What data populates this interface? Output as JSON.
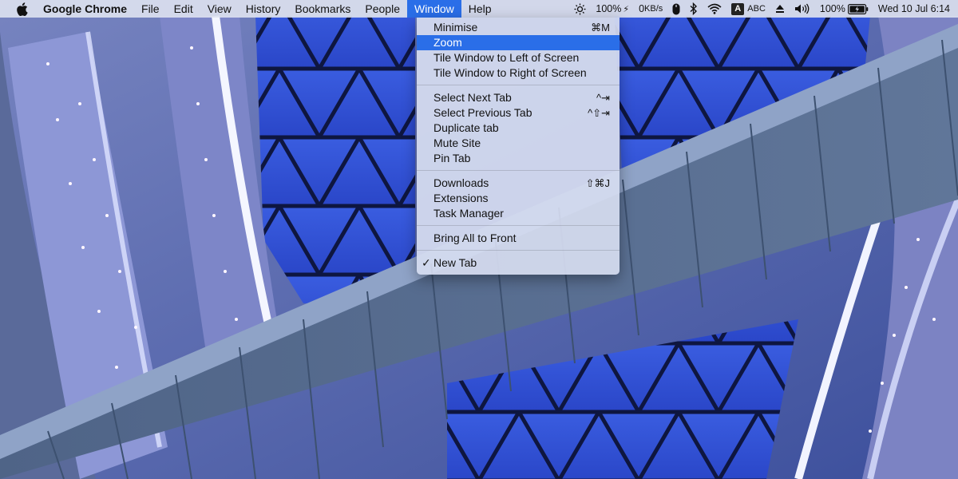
{
  "menubar": {
    "app_name": "Google Chrome",
    "menus": [
      "File",
      "Edit",
      "View",
      "History",
      "Bookmarks",
      "People",
      "Window",
      "Help"
    ],
    "active_menu": "Window"
  },
  "status_bar": {
    "brightness_value": "100%",
    "net_speed": "0",
    "net_unit": "KB/s",
    "input_source_letter": "A",
    "input_source": "ABC",
    "battery_percent": "100%",
    "datetime": "Wed 10 Jul  6:14"
  },
  "window_menu": {
    "groups": [
      [
        {
          "label": "Minimise",
          "shortcut": "⌘M"
        },
        {
          "label": "Zoom",
          "shortcut": "",
          "highlighted": true
        },
        {
          "label": "Tile Window to Left of Screen",
          "shortcut": ""
        },
        {
          "label": "Tile Window to Right of Screen",
          "shortcut": ""
        }
      ],
      [
        {
          "label": "Select Next Tab",
          "shortcut": "^⇥"
        },
        {
          "label": "Select Previous Tab",
          "shortcut": "^⇧⇥"
        },
        {
          "label": "Duplicate tab",
          "shortcut": ""
        },
        {
          "label": "Mute Site",
          "shortcut": ""
        },
        {
          "label": "Pin Tab",
          "shortcut": ""
        }
      ],
      [
        {
          "label": "Downloads",
          "shortcut": "⇧⌘J"
        },
        {
          "label": "Extensions",
          "shortcut": ""
        },
        {
          "label": "Task Manager",
          "shortcut": ""
        }
      ],
      [
        {
          "label": "Bring All to Front",
          "shortcut": ""
        }
      ],
      [
        {
          "label": "New Tab",
          "shortcut": "",
          "checked": true
        }
      ]
    ]
  },
  "colors": {
    "highlight": "#2a6ee8",
    "menubar_bg": "#dee2f0"
  }
}
